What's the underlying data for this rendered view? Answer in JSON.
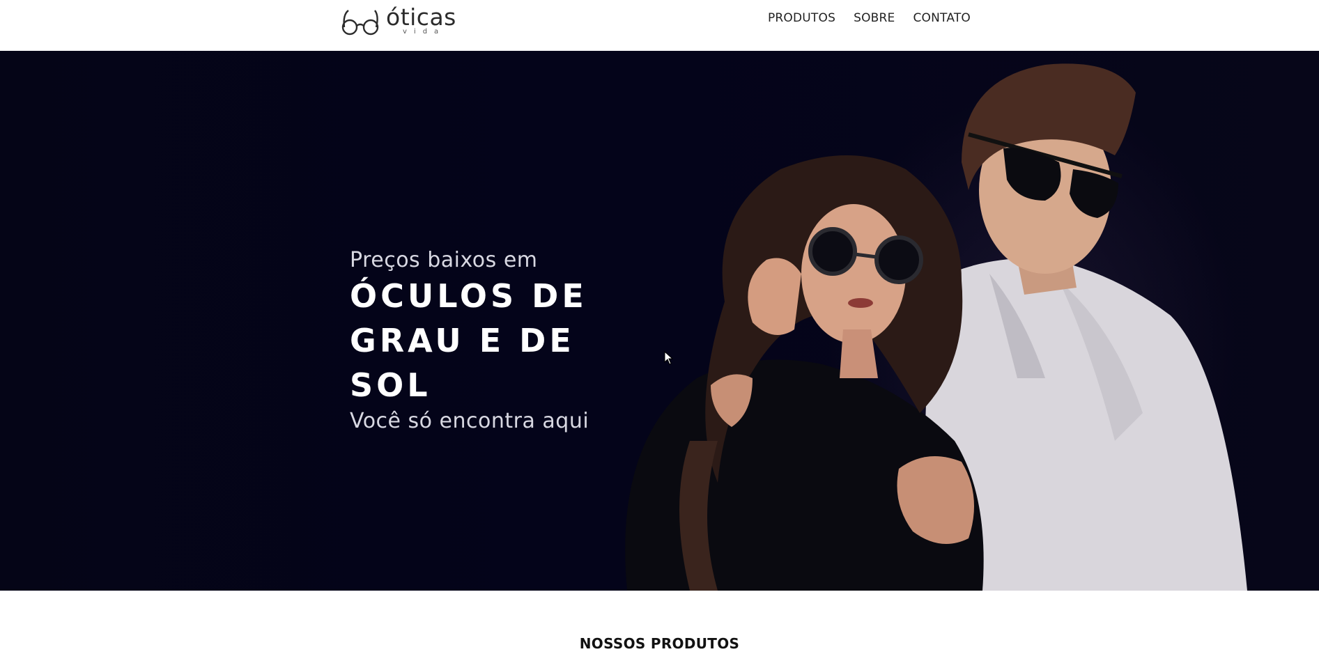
{
  "header": {
    "logo": {
      "name": "óticas",
      "sub": "vida"
    },
    "nav": [
      {
        "label": "PRODUTOS"
      },
      {
        "label": "SOBRE"
      },
      {
        "label": "CONTATO"
      }
    ]
  },
  "hero": {
    "pre": "Preços baixos em",
    "title_line1": "ÓCULOS DE",
    "title_line2": "GRAU E DE SOL",
    "post": "Você só encontra aqui"
  },
  "products": {
    "title": "NOSSOS PRODUTOS"
  },
  "colors": {
    "hero_bg": "#03020f",
    "text_dark": "#1a1a1a",
    "hero_text": "#ffffff"
  }
}
